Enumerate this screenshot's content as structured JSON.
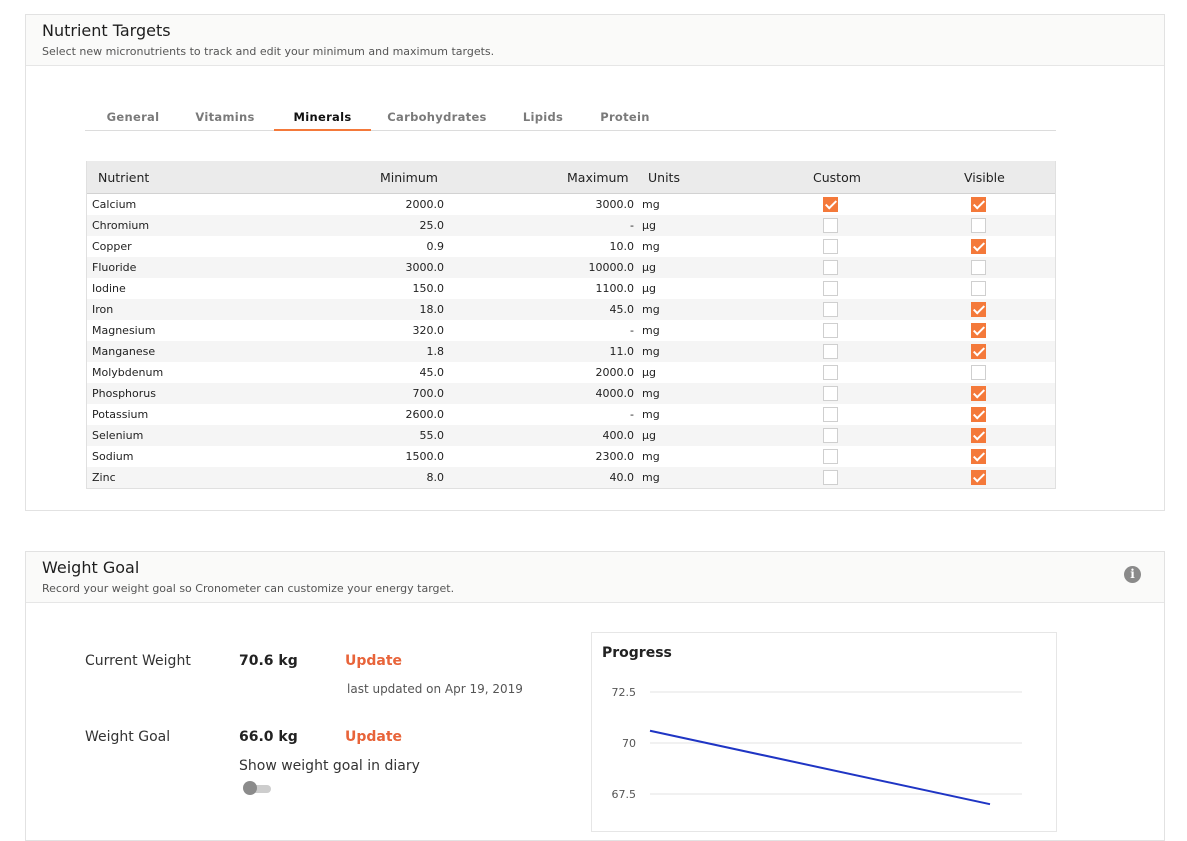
{
  "nutrient_targets": {
    "title": "Nutrient Targets",
    "subtitle": "Select new micronutrients to track and edit your minimum and maximum targets.",
    "tabs": [
      "General",
      "Vitamins",
      "Minerals",
      "Carbohydrates",
      "Lipids",
      "Protein"
    ],
    "active_tab": "Minerals",
    "columns": [
      "Nutrient",
      "Minimum",
      "Maximum",
      "Units",
      "Custom",
      "Visible"
    ],
    "rows": [
      {
        "name": "Calcium",
        "min": "2000.0",
        "max": "3000.0",
        "unit": "mg",
        "custom": true,
        "visible": true
      },
      {
        "name": "Chromium",
        "min": "25.0",
        "max": "-",
        "unit": "µg",
        "custom": false,
        "visible": false
      },
      {
        "name": "Copper",
        "min": "0.9",
        "max": "10.0",
        "unit": "mg",
        "custom": false,
        "visible": true
      },
      {
        "name": "Fluoride",
        "min": "3000.0",
        "max": "10000.0",
        "unit": "µg",
        "custom": false,
        "visible": false
      },
      {
        "name": "Iodine",
        "min": "150.0",
        "max": "1100.0",
        "unit": "µg",
        "custom": false,
        "visible": false
      },
      {
        "name": "Iron",
        "min": "18.0",
        "max": "45.0",
        "unit": "mg",
        "custom": false,
        "visible": true
      },
      {
        "name": "Magnesium",
        "min": "320.0",
        "max": "-",
        "unit": "mg",
        "custom": false,
        "visible": true
      },
      {
        "name": "Manganese",
        "min": "1.8",
        "max": "11.0",
        "unit": "mg",
        "custom": false,
        "visible": true
      },
      {
        "name": "Molybdenum",
        "min": "45.0",
        "max": "2000.0",
        "unit": "µg",
        "custom": false,
        "visible": false
      },
      {
        "name": "Phosphorus",
        "min": "700.0",
        "max": "4000.0",
        "unit": "mg",
        "custom": false,
        "visible": true
      },
      {
        "name": "Potassium",
        "min": "2600.0",
        "max": "-",
        "unit": "mg",
        "custom": false,
        "visible": true
      },
      {
        "name": "Selenium",
        "min": "55.0",
        "max": "400.0",
        "unit": "µg",
        "custom": false,
        "visible": true
      },
      {
        "name": "Sodium",
        "min": "1500.0",
        "max": "2300.0",
        "unit": "mg",
        "custom": false,
        "visible": true
      },
      {
        "name": "Zinc",
        "min": "8.0",
        "max": "40.0",
        "unit": "mg",
        "custom": false,
        "visible": true
      }
    ]
  },
  "weight_goal": {
    "title": "Weight Goal",
    "subtitle": "Record your weight goal so Cronometer can customize your energy target.",
    "info_icon": "info-icon",
    "current_weight_label": "Current Weight",
    "current_weight_value": "70.6 kg",
    "update_label": "Update",
    "last_updated": "last updated on Apr 19, 2019",
    "goal_label": "Weight Goal",
    "goal_value": "66.0 kg",
    "show_in_diary_label": "Show weight goal in diary",
    "show_in_diary_on": false
  },
  "colors": {
    "accent": "#f4793a",
    "link": "#e8643a",
    "chart_line": "#1f35c4"
  },
  "chart_data": {
    "type": "line",
    "title": "Progress",
    "y_ticks": [
      "72.5",
      "70",
      "67.5"
    ],
    "series": [
      {
        "x": [
          0,
          1
        ],
        "values": [
          70.6,
          67.0
        ]
      }
    ],
    "ylim": [
      66.0,
      72.5
    ],
    "grid": true
  }
}
